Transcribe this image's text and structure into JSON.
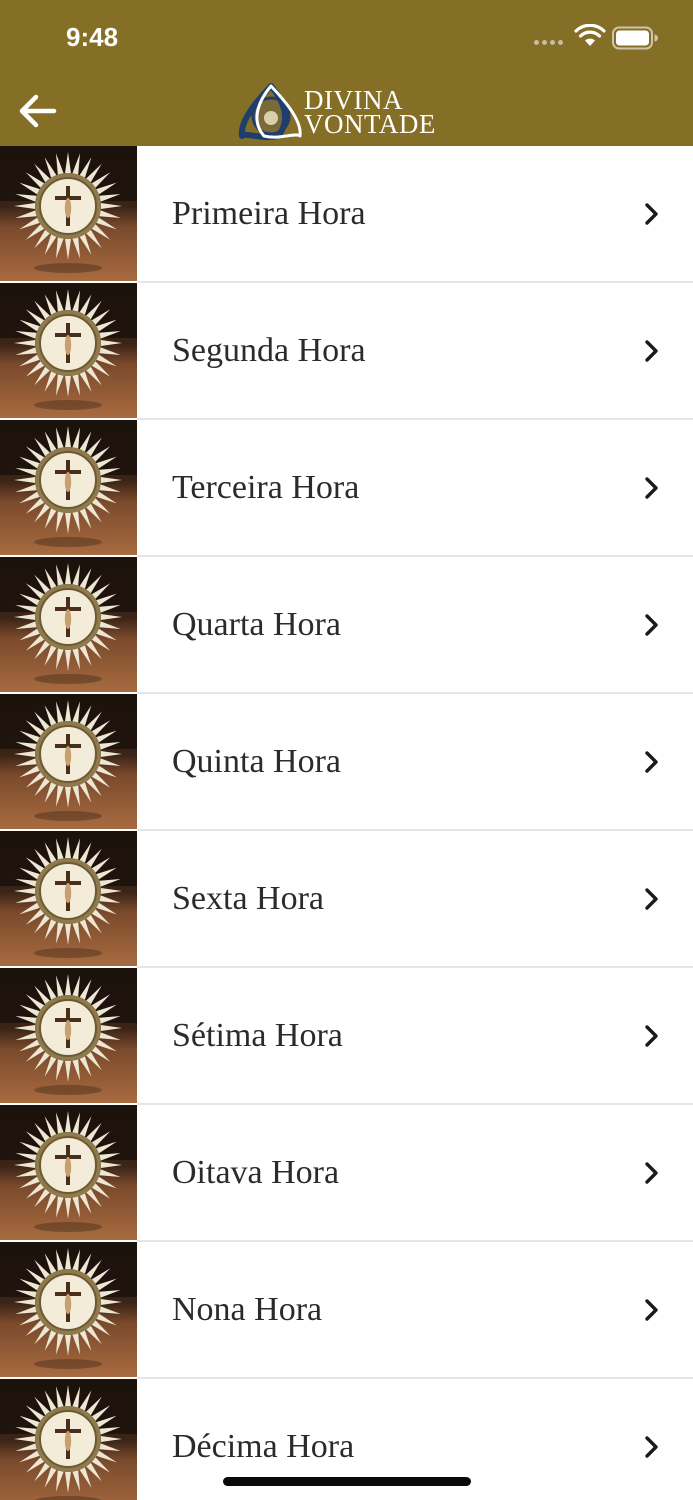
{
  "status_bar": {
    "time": "9:48",
    "icons": [
      "cellular-signal-icon",
      "wifi-icon",
      "battery-icon"
    ]
  },
  "nav": {
    "back_icon": "arrow-left-icon",
    "logo_line1": "DIVINA",
    "logo_line2": "VONTADE",
    "logo_icon": "trinity-knot-logo"
  },
  "colors": {
    "header": "#856f27",
    "row_text": "#2b2b2b",
    "divider": "#e6e6e6",
    "background": "#ffffff"
  },
  "hours": [
    {
      "label": "Primeira Hora"
    },
    {
      "label": "Segunda Hora"
    },
    {
      "label": "Terceira Hora"
    },
    {
      "label": "Quarta Hora"
    },
    {
      "label": "Quinta Hora"
    },
    {
      "label": "Sexta Hora"
    },
    {
      "label": "Sétima Hora"
    },
    {
      "label": "Oitava Hora"
    },
    {
      "label": "Nona Hora"
    },
    {
      "label": "Décima Hora"
    }
  ],
  "row_icons": {
    "thumbnail": "crucifix-clock-image",
    "chevron": "chevron-right-icon"
  }
}
